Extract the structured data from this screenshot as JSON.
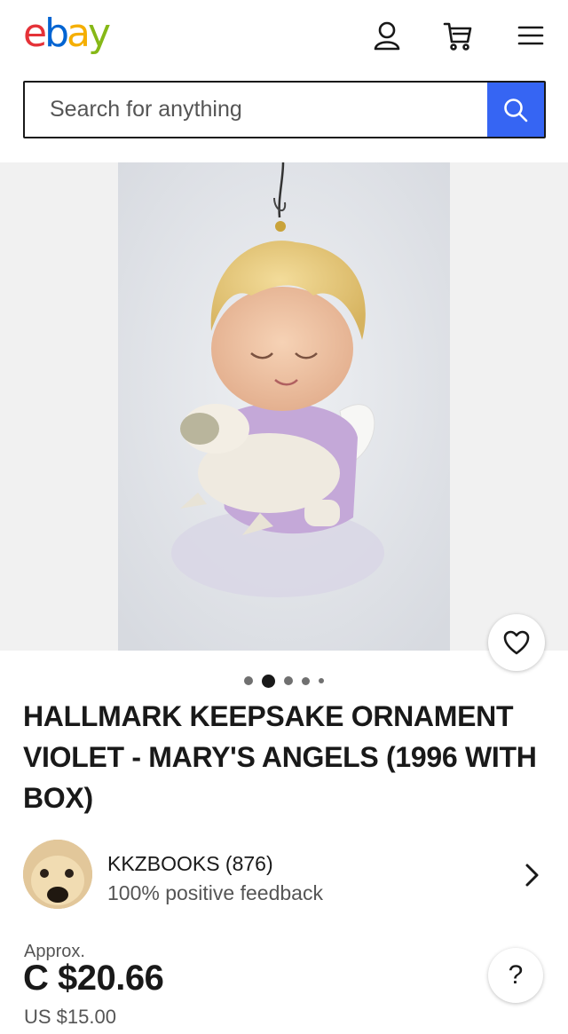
{
  "header": {
    "logo_letters": [
      "e",
      "b",
      "a",
      "y"
    ],
    "logo_colors": [
      "#e53238",
      "#0064d2",
      "#f5af02",
      "#86b817"
    ]
  },
  "search": {
    "placeholder": "Search for anything"
  },
  "gallery": {
    "image_count": 5,
    "active_index": 1
  },
  "listing": {
    "title": "HALLMARK KEEPSAKE ORNAMENT VIOLET - MARY'S ANGELS (1996 WITH BOX)"
  },
  "seller": {
    "name": "KKZBOOKS (876)",
    "feedback": "100% positive feedback"
  },
  "price": {
    "approx_label": "Approx.",
    "converted": "C $20.66",
    "original": "US $15.00"
  },
  "help": {
    "label": "?"
  },
  "colors": {
    "accent": "#3665f3"
  }
}
